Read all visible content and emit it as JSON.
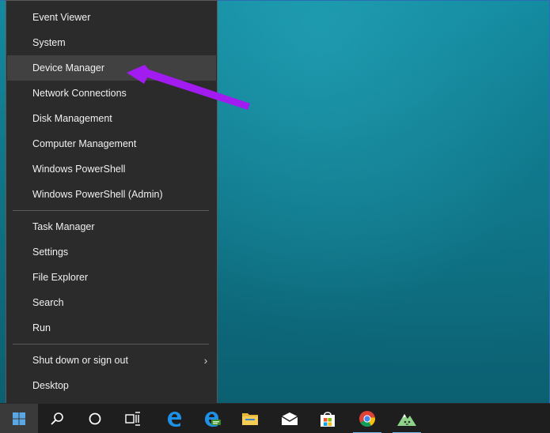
{
  "menu": {
    "group1": [
      {
        "label": "Event Viewer"
      },
      {
        "label": "System"
      },
      {
        "label": "Device Manager"
      },
      {
        "label": "Network Connections"
      },
      {
        "label": "Disk Management"
      },
      {
        "label": "Computer Management"
      },
      {
        "label": "Windows PowerShell"
      },
      {
        "label": "Windows PowerShell (Admin)"
      }
    ],
    "group2": [
      {
        "label": "Task Manager"
      },
      {
        "label": "Settings"
      },
      {
        "label": "File Explorer"
      },
      {
        "label": "Search"
      },
      {
        "label": "Run"
      }
    ],
    "group3": [
      {
        "label": "Shut down or sign out",
        "submenu_glyph": "›"
      },
      {
        "label": "Desktop"
      }
    ]
  },
  "annotation": {
    "arrow_color": "#a21cf2",
    "points_to": "Device Manager"
  },
  "taskbar": {
    "items": [
      {
        "icon": "windows-start-icon"
      },
      {
        "icon": "search-icon"
      },
      {
        "icon": "cortana-icon"
      },
      {
        "icon": "task-view-icon"
      },
      {
        "icon": "edge-icon"
      },
      {
        "icon": "edge-beta-icon"
      },
      {
        "icon": "file-explorer-icon"
      },
      {
        "icon": "mail-icon"
      },
      {
        "icon": "store-icon"
      },
      {
        "icon": "chrome-icon"
      },
      {
        "icon": "pinned-app-icon"
      }
    ]
  },
  "colors": {
    "menu_bg": "#2b2b2b",
    "menu_hover": "#414141",
    "taskbar_bg": "#1e1e1e",
    "accent": "#76b9ed",
    "desktop": "#0f7487"
  }
}
